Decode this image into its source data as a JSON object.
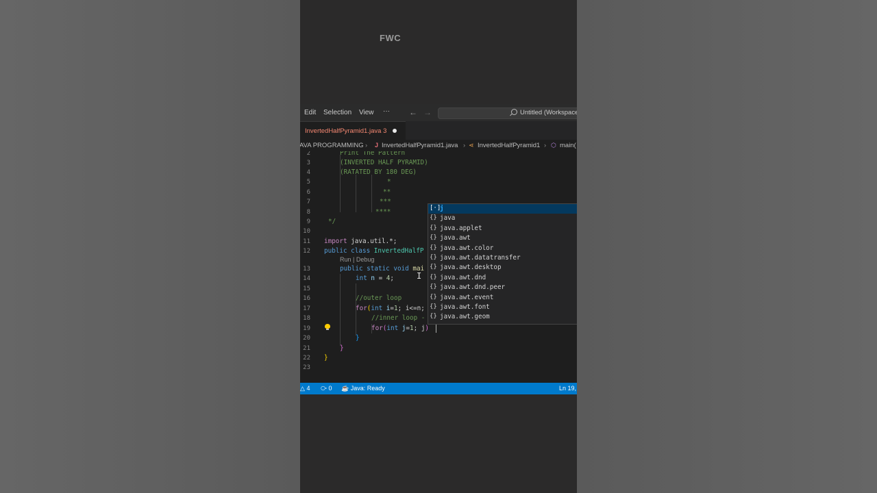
{
  "watermark": "FWC",
  "menu": {
    "items": [
      "Edit",
      "Selection",
      "View",
      "···"
    ],
    "back_icon": "arrow-left-icon",
    "forward_icon": "arrow-right-icon"
  },
  "search": {
    "text": "Untitled (Workspace)",
    "icon": "search-icon"
  },
  "tab": {
    "filename": "InvertedHalfPyramid1.java",
    "problems": "3",
    "modified": true
  },
  "breadcrumb": {
    "folder": "AVA PROGRAMMING",
    "file": "InvertedHalfPyramid1.java",
    "class": "InvertedHalfPyramid1",
    "method": "main("
  },
  "editor": {
    "codelens": "Run | Debug",
    "line_numbers": [
      "2",
      "3",
      "4",
      "5",
      "6",
      "7",
      "8",
      "9",
      "10",
      "11",
      "12",
      "13",
      "14",
      "15",
      "16",
      "17",
      "18",
      "19",
      "20",
      "21",
      "22",
      "23"
    ],
    "lines": {
      "l2": "Print The Pattern",
      "l3": "(INVERTED HALF PYRAMID)",
      "l4": "(RATATED BY 180 DEG)",
      "l5": "*",
      "l6": "**",
      "l7": "***",
      "l8": "****",
      "l9": "*/",
      "l11_kw": "import",
      "l11_rest": " java.util.*;",
      "l12_kw": "public class",
      "l12_cls": " InvertedHalfP",
      "l13_kw": "public static void",
      "l13_fn": " mai",
      "l14_kw": "int",
      "l14_var": " n",
      "l14_op": " = ",
      "l14_num": "4",
      "l14_end": ";",
      "l16": "//outer loop",
      "l17_kw": "for",
      "l17_p": "(",
      "l17_kw2": "int",
      "l17_var": " i",
      "l17_op": "=",
      "l17_num": "1",
      "l17_rest": "; i<=n;",
      "l18": "//inner loop -",
      "l19_kw": "for",
      "l19_p": "(",
      "l19_kw2": "int",
      "l19_var": " j",
      "l19_op": "=",
      "l19_num": "1",
      "l19_rest": "; j",
      "l19_close": ")",
      "l20": "}",
      "l21": "}",
      "l22": "}"
    }
  },
  "suggestions": [
    {
      "icon": "variable-icon",
      "glyph": "[·]",
      "label": "j",
      "selected": true
    },
    {
      "icon": "package-icon",
      "glyph": "{}",
      "label": "java"
    },
    {
      "icon": "package-icon",
      "glyph": "{}",
      "label": "java.applet"
    },
    {
      "icon": "package-icon",
      "glyph": "{}",
      "label": "java.awt"
    },
    {
      "icon": "package-icon",
      "glyph": "{}",
      "label": "java.awt.color"
    },
    {
      "icon": "package-icon",
      "glyph": "{}",
      "label": "java.awt.datatransfer"
    },
    {
      "icon": "package-icon",
      "glyph": "{}",
      "label": "java.awt.desktop"
    },
    {
      "icon": "package-icon",
      "glyph": "{}",
      "label": "java.awt.dnd"
    },
    {
      "icon": "package-icon",
      "glyph": "{}",
      "label": "java.awt.dnd.peer"
    },
    {
      "icon": "package-icon",
      "glyph": "{}",
      "label": "java.awt.event"
    },
    {
      "icon": "package-icon",
      "glyph": "{}",
      "label": "java.awt.font"
    },
    {
      "icon": "package-icon",
      "glyph": "{}",
      "label": "java.awt.geom"
    }
  ],
  "status": {
    "warnings": "4",
    "ports": "0",
    "java": "Java: Ready",
    "position": "Ln 19,"
  },
  "colors": {
    "statusbar": "#007acc",
    "editor_bg": "#1e1e1e",
    "selection": "#04395e"
  }
}
